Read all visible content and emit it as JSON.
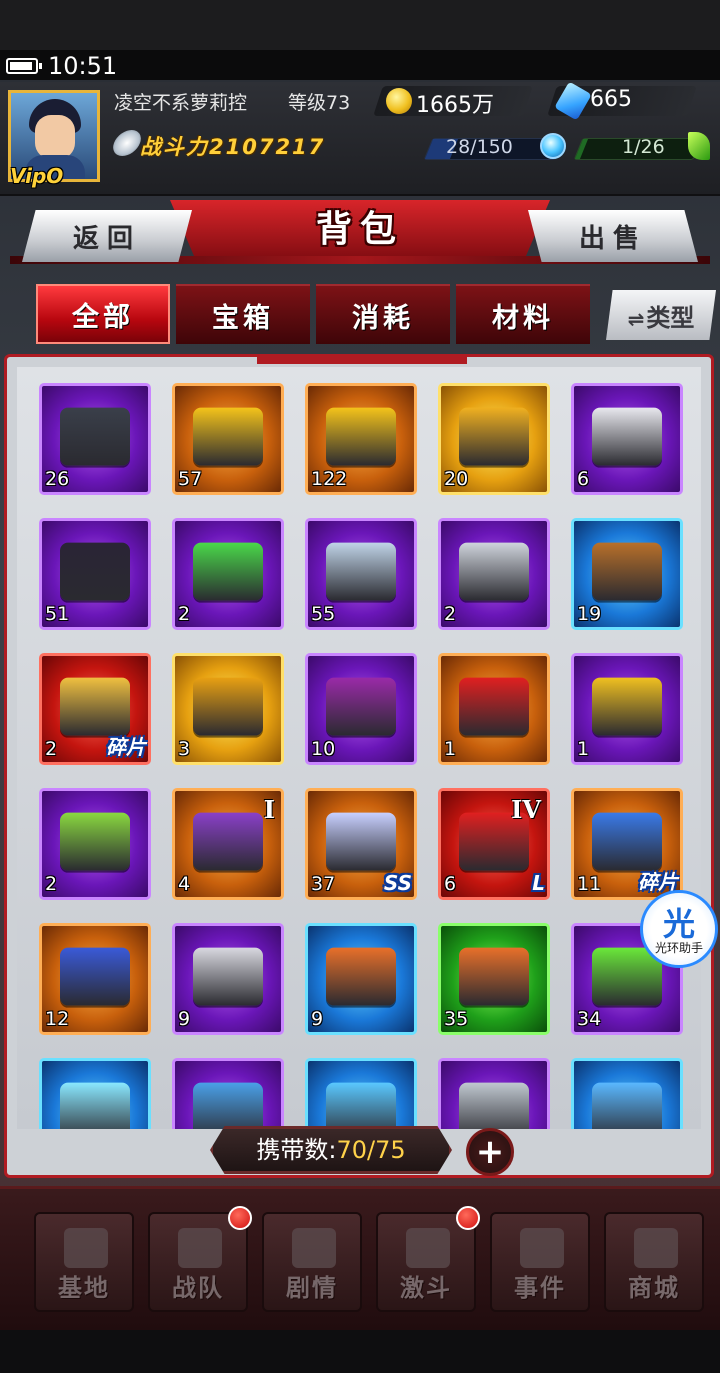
{
  "status_bar": {
    "time": "10:51"
  },
  "player": {
    "name": "凌空不系萝莉控",
    "level": "等级73",
    "vip": "VIP0",
    "vip_display": "VipO",
    "gold": "1665万",
    "diamonds": "665",
    "power_label": "战斗力",
    "power_value": "2107217",
    "stamina": "28/150",
    "stamina_fraction": 0.19,
    "energy": "1/26",
    "energy_fraction": 0.04
  },
  "header": {
    "title": "背包",
    "back_label": "返回",
    "sell_label": "出售"
  },
  "tabs": [
    {
      "label": "全部",
      "active": true
    },
    {
      "label": "宝箱",
      "active": false
    },
    {
      "label": "消耗",
      "active": false
    },
    {
      "label": "材料",
      "active": false
    }
  ],
  "type_button": {
    "label": "类型",
    "icon": "swap-arrows-icon"
  },
  "items": [
    {
      "name": "weapon-case",
      "count": "26",
      "rarity": "purple"
    },
    {
      "name": "gold-coin-chest",
      "count": "57",
      "rarity": "orange"
    },
    {
      "name": "gold-coin-chest-large",
      "count": "122",
      "rarity": "orange"
    },
    {
      "name": "gold-sack",
      "count": "20",
      "rarity": "gold"
    },
    {
      "name": "capsule-box",
      "count": "6",
      "rarity": "purple"
    },
    {
      "name": "monster-cage",
      "count": "51",
      "rarity": "purple"
    },
    {
      "name": "green-core-box",
      "count": "2",
      "rarity": "purple"
    },
    {
      "name": "silver-chest",
      "count": "55",
      "rarity": "purple"
    },
    {
      "name": "silver-key",
      "count": "2",
      "rarity": "purple"
    },
    {
      "name": "wooden-chest",
      "count": "19",
      "rarity": "blue"
    },
    {
      "name": "mecha-fragment-box",
      "count": "2",
      "rarity": "red",
      "tag": "碎片"
    },
    {
      "name": "gold-crate",
      "count": "3",
      "rarity": "gold"
    },
    {
      "name": "purple-crate",
      "count": "10",
      "rarity": "purple"
    },
    {
      "name": "red-energy-egg",
      "count": "1",
      "rarity": "orange"
    },
    {
      "name": "black-gold-gift",
      "count": "1",
      "rarity": "purple"
    },
    {
      "name": "green-battery-box",
      "count": "2",
      "rarity": "purple"
    },
    {
      "name": "purple-gift-box-I",
      "count": "4",
      "rarity": "orange",
      "roman": "I"
    },
    {
      "name": "rainbow-crystal",
      "count": "37",
      "rarity": "orange",
      "tag": "SS"
    },
    {
      "name": "red-gift-IV",
      "count": "6",
      "rarity": "red",
      "roman": "IV",
      "tag": "L"
    },
    {
      "name": "hero-helmet-fragment",
      "count": "11",
      "rarity": "orange",
      "tag": "碎片"
    },
    {
      "name": "blue-mecha-helmet",
      "count": "12",
      "rarity": "orange"
    },
    {
      "name": "silver-canister",
      "count": "9",
      "rarity": "purple"
    },
    {
      "name": "orange-canister",
      "count": "9",
      "rarity": "blue"
    },
    {
      "name": "orange-barrel",
      "count": "35",
      "rarity": "green"
    },
    {
      "name": "green-energy-cell",
      "count": "34",
      "rarity": "purple"
    },
    {
      "name": "green-vial",
      "count": "",
      "rarity": "blue"
    },
    {
      "name": "blue-flask",
      "count": "",
      "rarity": "purple"
    },
    {
      "name": "blue-tube",
      "count": "",
      "rarity": "blue"
    },
    {
      "name": "silver-bottle",
      "count": "",
      "rarity": "purple"
    },
    {
      "name": "blue-capsule",
      "count": "",
      "rarity": "blue"
    }
  ],
  "capacity": {
    "label": "携带数:",
    "value": "70/75"
  },
  "helper": {
    "glyph": "光",
    "label": "光环助手"
  },
  "nav": [
    {
      "label": "基地",
      "icon": "base-icon",
      "notify": false
    },
    {
      "label": "战队",
      "icon": "team-icon",
      "notify": true
    },
    {
      "label": "剧情",
      "icon": "story-icon",
      "notify": false
    },
    {
      "label": "激斗",
      "icon": "battle-icon",
      "notify": true
    },
    {
      "label": "事件",
      "icon": "event-icon",
      "notify": false
    },
    {
      "label": "商城",
      "icon": "shop-cart-icon",
      "notify": false
    }
  ],
  "colors": {
    "accent_red": "#c4150f",
    "gold_text": "#ffd24a",
    "rarity_purple": "#6a16b8",
    "rarity_orange": "#c8600c",
    "rarity_gold": "#e6a010",
    "rarity_red": "#c4150f",
    "rarity_blue": "#1a78d8",
    "rarity_green": "#1fa01a"
  }
}
